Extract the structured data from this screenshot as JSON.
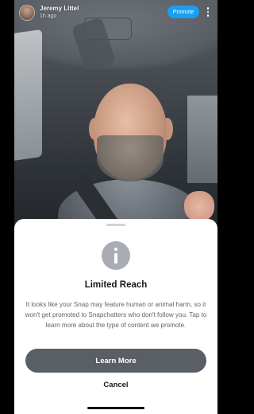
{
  "post": {
    "username": "Jeremy Littel",
    "timestamp": "1h ago",
    "promote_label": "Promote",
    "more_icon": "more-vertical-icon"
  },
  "sheet": {
    "icon": "info-icon",
    "title": "Limited Reach",
    "body": "It looks like your Snap may feature human or animal harm, so it won't get promoted to Snapchatters who don't follow you. Tap to learn more about the type of content we promote.",
    "learn_more_label": "Learn More",
    "cancel_label": "Cancel"
  },
  "colors": {
    "promote_button": "#1a9ef0",
    "learn_more_button": "#5a5f66",
    "info_icon": "#a9adb3"
  }
}
